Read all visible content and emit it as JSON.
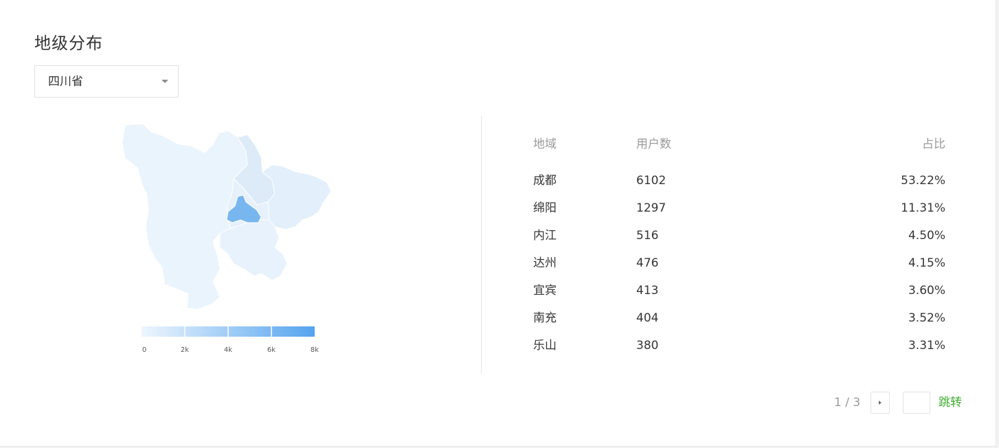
{
  "section_title": "地级分布",
  "province_select": {
    "value": "四川省"
  },
  "map": {
    "legend_ticks": [
      "0",
      "2k",
      "4k",
      "6k",
      "8k"
    ],
    "legend_max": 8000,
    "colors": {
      "low": "#eaf4fd",
      "high": "#55a4ee",
      "highlight": "#78b6ef",
      "border": "#ffffff"
    },
    "highlighted_region_value": 6102
  },
  "table": {
    "headers": {
      "region": "地域",
      "users": "用户数",
      "pct": "占比"
    },
    "rows": [
      {
        "region": "成都",
        "users": "6102",
        "pct": "53.22%"
      },
      {
        "region": "绵阳",
        "users": "1297",
        "pct": "11.31%"
      },
      {
        "region": "内江",
        "users": "516",
        "pct": "4.50%"
      },
      {
        "region": "达州",
        "users": "476",
        "pct": "4.15%"
      },
      {
        "region": "宜宾",
        "users": "413",
        "pct": "3.60%"
      },
      {
        "region": "南充",
        "users": "404",
        "pct": "3.52%"
      },
      {
        "region": "乐山",
        "users": "380",
        "pct": "3.31%"
      }
    ]
  },
  "pagination": {
    "page_text": "1 / 3",
    "jump_value": "",
    "jump_label": "跳转",
    "accent_color": "#3fae2e"
  }
}
